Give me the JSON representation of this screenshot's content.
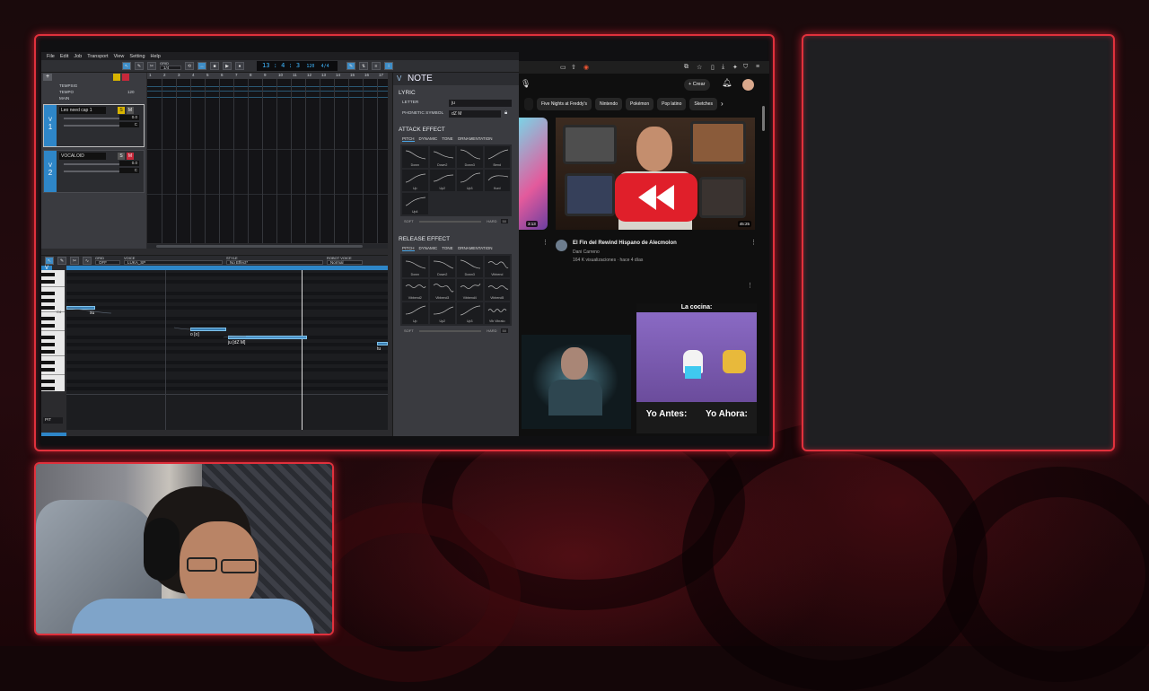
{
  "vocaloid": {
    "menu": [
      "File",
      "Edit",
      "Job",
      "Transport",
      "View",
      "Setting",
      "Help"
    ],
    "grid_label": "GRID",
    "grid_value": "1/4",
    "time_display": "13 : 4 : 3",
    "tempo_value": "120",
    "time_signature": "4/4",
    "rows": [
      "TEMPSIG",
      "TEMPO",
      "MAIN"
    ],
    "tempo_row_value": "120",
    "tracks": [
      {
        "num": "1",
        "name": "Leo need cap 1",
        "vol": "0.0",
        "pan": "C"
      },
      {
        "num": "2",
        "name": "VOCALOID",
        "vol": "0.0",
        "pan": "C"
      }
    ],
    "ruler_marks": [
      "1",
      "2",
      "3",
      "4",
      "5",
      "6",
      "7",
      "8",
      "9",
      "10",
      "11",
      "12",
      "13",
      "14",
      "15",
      "16",
      "17"
    ],
    "lower_toolbar": {
      "grid_label": "GRID",
      "grid_value": "OFF",
      "voice_label": "VOICE",
      "voice_value": "LUKA_SP",
      "style_label": "STYLE",
      "style_value": "No Effect*",
      "robot_label": "ROBOT VOICE",
      "robot_value": "Normal"
    },
    "piano_label": "C4",
    "notes": [
      {
        "lyric": "su"
      },
      {
        "lyric": "o [o]"
      },
      {
        "lyric": "ju [dZ M]"
      },
      {
        "lyric": "tu"
      }
    ],
    "param_label": "PIT",
    "note_panel": {
      "title": "NOTE",
      "lyric_section": "LYRIC",
      "letter_label": "LETTER",
      "letter_value": "ju",
      "phonetic_label": "PHONETIC SYMBOL",
      "phonetic_value": "dZ M",
      "attack_section": "ATTACK EFFECT",
      "release_section": "RELEASE EFFECT",
      "tabs": [
        "PITCH",
        "DYNAMIC",
        "TONE",
        "ORNAMENTATION"
      ],
      "attack_fx": [
        "Down",
        "Down2",
        "Down3",
        "Bend",
        "Up",
        "Up2",
        "Up3",
        "Kurd",
        "Up4"
      ],
      "release_fx": [
        "Down",
        "Down2",
        "Down3",
        "Vibbend",
        "Vibbend2",
        "Vibbend3",
        "Vibbend4",
        "Vibbend5",
        "Up",
        "Up2",
        "Up3",
        "Vib Vibrato"
      ],
      "soft": "SOFT",
      "hard": "HARD",
      "attack_amount": "50",
      "release_amount": "50"
    }
  },
  "youtube": {
    "create_label": "+ Crear",
    "chips": [
      "Five Nights at Freddy's",
      "Nintendo",
      "Pokémon",
      "Pop latino",
      "Sketches"
    ],
    "left_duration": "3:13",
    "main_duration": "45:25",
    "video_title": "El Fin del Rewind Hispano de Alecmolon",
    "channel": "Dani Carreno",
    "meta": "164 K visualizaciones · hace 4 días",
    "short_b_caption_top": "La cocina:",
    "short_b_left": "Yo Antes:",
    "short_b_right": "Yo Ahora:"
  },
  "colors": {
    "frame_border": "#e0313c",
    "vocaloid_accent": "#2e86c8",
    "youtube_bg": "#0f0f0f"
  }
}
